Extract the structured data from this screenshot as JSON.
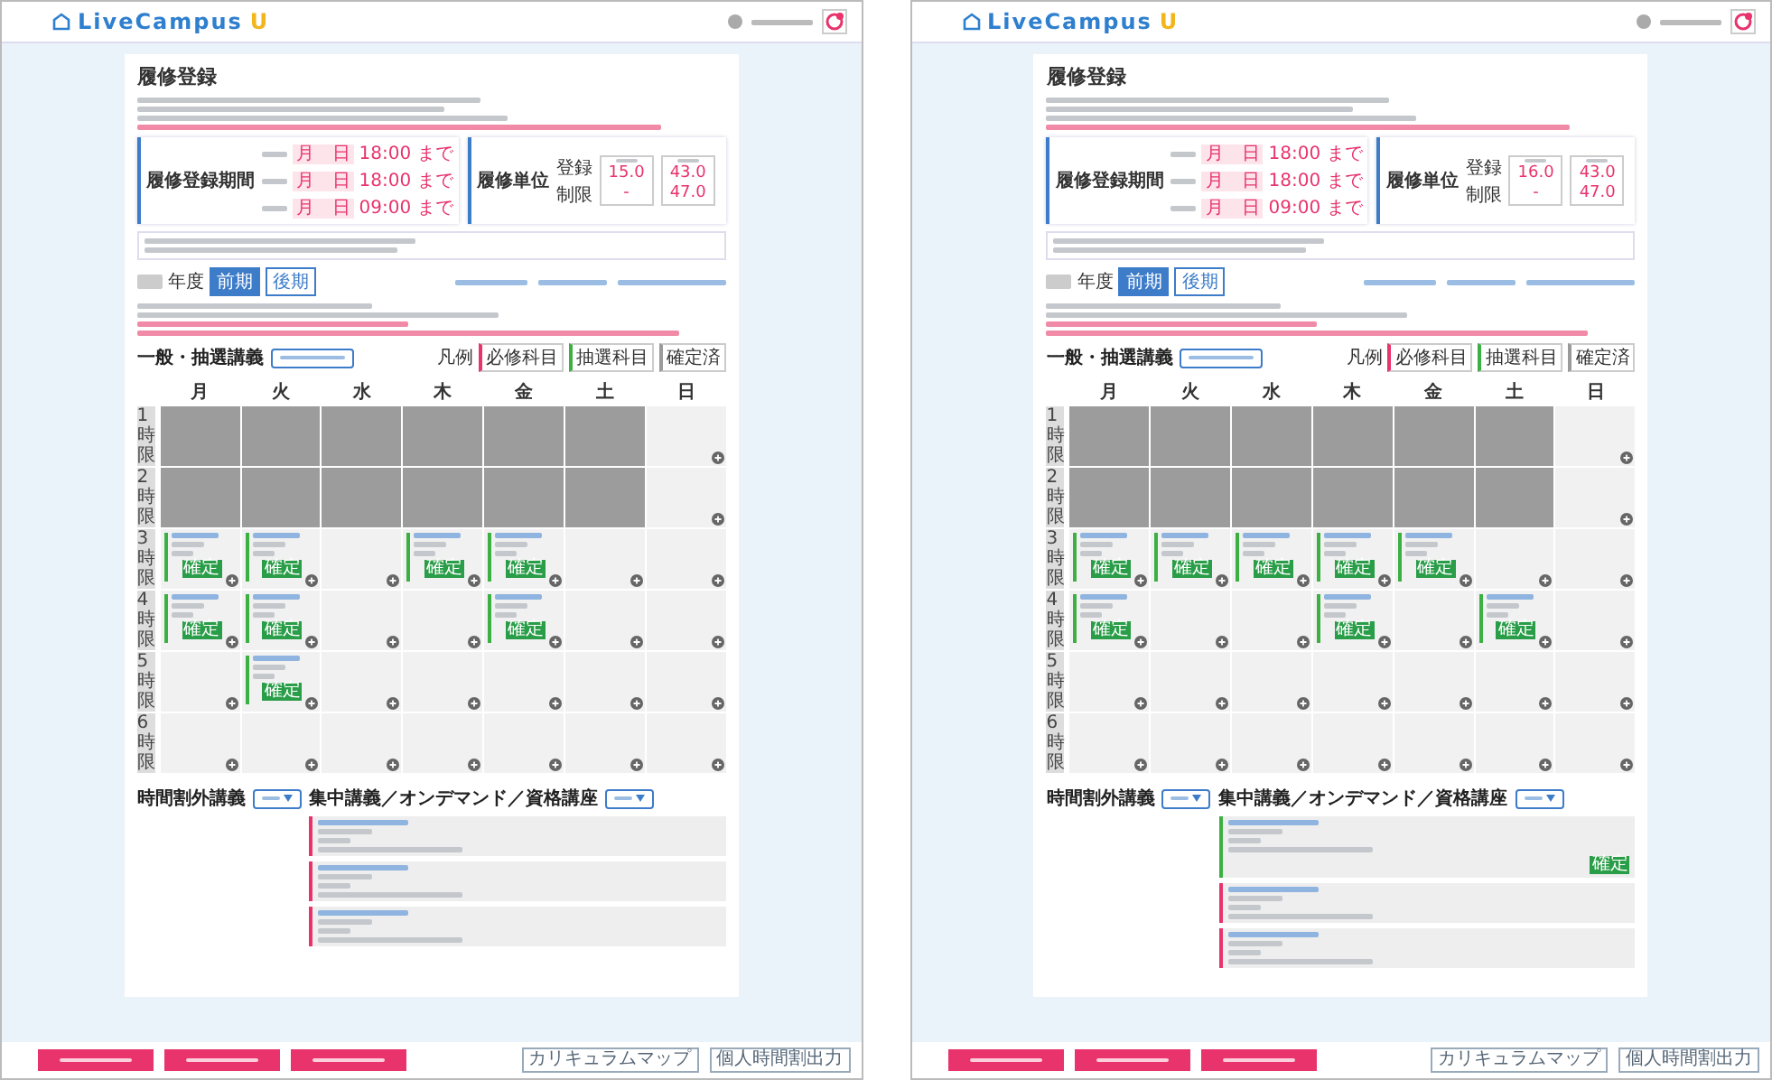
{
  "screens": [
    {
      "logo": {
        "name": "LiveCampus",
        "mark": "U"
      },
      "title": "履修登録",
      "period": {
        "label": "履修登録期間",
        "rows": [
          {
            "month": "月",
            "day": "日",
            "time": "18:00",
            "suffix": "まで"
          },
          {
            "month": "月",
            "day": "日",
            "time": "18:00",
            "suffix": "まで"
          },
          {
            "month": "月",
            "day": "日",
            "time": "09:00",
            "suffix": "まで"
          }
        ]
      },
      "units": {
        "label": "履修単位",
        "row_labels": [
          "登録",
          "制限"
        ],
        "columns": [
          [
            "15.0",
            "-"
          ],
          [
            "43.0",
            "47.0"
          ]
        ]
      },
      "year_suffix": "年度",
      "terms": [
        {
          "label": "前期",
          "selected": true
        },
        {
          "label": "後期",
          "selected": false
        }
      ],
      "grid_title": "一般・抽選講義",
      "legend": {
        "title": "凡例",
        "items": [
          {
            "label": "必修科目",
            "color": "#e8336d"
          },
          {
            "label": "抽選科目",
            "color": "#3cb043"
          },
          {
            "label": "確定済",
            "color": "#9a9a9a"
          }
        ]
      },
      "days": [
        "月",
        "火",
        "水",
        "木",
        "金",
        "土",
        "日"
      ],
      "periods": [
        "1時限",
        "2時限",
        "3時限",
        "4時限",
        "5時限",
        "6時限"
      ],
      "rows": [
        [
          {
            "kind": "blocked"
          },
          {
            "kind": "blocked"
          },
          {
            "kind": "blocked"
          },
          {
            "kind": "blocked"
          },
          {
            "kind": "blocked"
          },
          {
            "kind": "blocked"
          },
          {
            "kind": "empty"
          }
        ],
        [
          {
            "kind": "blocked"
          },
          {
            "kind": "blocked"
          },
          {
            "kind": "blocked"
          },
          {
            "kind": "blocked"
          },
          {
            "kind": "blocked"
          },
          {
            "kind": "blocked"
          },
          {
            "kind": "empty"
          }
        ],
        [
          {
            "kind": "course",
            "badge": "確定"
          },
          {
            "kind": "course",
            "badge": "確定"
          },
          {
            "kind": "empty"
          },
          {
            "kind": "course",
            "badge": "確定"
          },
          {
            "kind": "course",
            "badge": "確定"
          },
          {
            "kind": "empty"
          },
          {
            "kind": "empty"
          }
        ],
        [
          {
            "kind": "course",
            "badge": "確定"
          },
          {
            "kind": "course",
            "badge": "確定"
          },
          {
            "kind": "empty"
          },
          {
            "kind": "empty"
          },
          {
            "kind": "course",
            "badge": "確定"
          },
          {
            "kind": "empty"
          },
          {
            "kind": "empty"
          }
        ],
        [
          {
            "kind": "empty"
          },
          {
            "kind": "course",
            "badge": "確定"
          },
          {
            "kind": "empty"
          },
          {
            "kind": "empty"
          },
          {
            "kind": "empty"
          },
          {
            "kind": "empty"
          },
          {
            "kind": "empty"
          }
        ],
        [
          {
            "kind": "empty"
          },
          {
            "kind": "empty"
          },
          {
            "kind": "empty"
          },
          {
            "kind": "empty"
          },
          {
            "kind": "empty"
          },
          {
            "kind": "empty"
          },
          {
            "kind": "empty"
          }
        ]
      ],
      "extra_title": "時間割外講義",
      "intensive_title": "集中講義／オンデマンド／資格講座",
      "intensive": [
        {
          "color": "#e8336d"
        },
        {
          "color": "#e8336d"
        },
        {
          "color": "#e8336d"
        }
      ],
      "footer_right": [
        "カリキュラムマップ",
        "個人時間割出力"
      ]
    },
    {
      "logo": {
        "name": "LiveCampus",
        "mark": "U"
      },
      "title": "履修登録",
      "period": {
        "label": "履修登録期間",
        "rows": [
          {
            "month": "月",
            "day": "日",
            "time": "18:00",
            "suffix": "まで"
          },
          {
            "month": "月",
            "day": "日",
            "time": "18:00",
            "suffix": "まで"
          },
          {
            "month": "月",
            "day": "日",
            "time": "09:00",
            "suffix": "まで"
          }
        ]
      },
      "units": {
        "label": "履修単位",
        "row_labels": [
          "登録",
          "制限"
        ],
        "columns": [
          [
            "16.0",
            "-"
          ],
          [
            "43.0",
            "47.0"
          ]
        ]
      },
      "year_suffix": "年度",
      "terms": [
        {
          "label": "前期",
          "selected": true
        },
        {
          "label": "後期",
          "selected": false
        }
      ],
      "grid_title": "一般・抽選講義",
      "legend": {
        "title": "凡例",
        "items": [
          {
            "label": "必修科目",
            "color": "#e8336d"
          },
          {
            "label": "抽選科目",
            "color": "#3cb043"
          },
          {
            "label": "確定済",
            "color": "#9a9a9a"
          }
        ]
      },
      "days": [
        "月",
        "火",
        "水",
        "木",
        "金",
        "土",
        "日"
      ],
      "periods": [
        "1時限",
        "2時限",
        "3時限",
        "4時限",
        "5時限",
        "6時限"
      ],
      "rows": [
        [
          {
            "kind": "blocked"
          },
          {
            "kind": "blocked"
          },
          {
            "kind": "blocked"
          },
          {
            "kind": "blocked"
          },
          {
            "kind": "blocked"
          },
          {
            "kind": "blocked"
          },
          {
            "kind": "empty"
          }
        ],
        [
          {
            "kind": "blocked"
          },
          {
            "kind": "blocked"
          },
          {
            "kind": "blocked"
          },
          {
            "kind": "blocked"
          },
          {
            "kind": "blocked"
          },
          {
            "kind": "blocked"
          },
          {
            "kind": "empty"
          }
        ],
        [
          {
            "kind": "course",
            "badge": "確定"
          },
          {
            "kind": "course",
            "badge": "確定"
          },
          {
            "kind": "course",
            "badge": "確定"
          },
          {
            "kind": "course",
            "badge": "確定"
          },
          {
            "kind": "course",
            "badge": "確定"
          },
          {
            "kind": "empty"
          },
          {
            "kind": "empty"
          }
        ],
        [
          {
            "kind": "course",
            "badge": "確定"
          },
          {
            "kind": "empty"
          },
          {
            "kind": "empty"
          },
          {
            "kind": "course",
            "badge": "確定"
          },
          {
            "kind": "empty"
          },
          {
            "kind": "course",
            "badge": "確定"
          },
          {
            "kind": "empty"
          }
        ],
        [
          {
            "kind": "empty"
          },
          {
            "kind": "empty"
          },
          {
            "kind": "empty"
          },
          {
            "kind": "empty"
          },
          {
            "kind": "empty"
          },
          {
            "kind": "empty"
          },
          {
            "kind": "empty"
          }
        ],
        [
          {
            "kind": "empty"
          },
          {
            "kind": "empty"
          },
          {
            "kind": "empty"
          },
          {
            "kind": "empty"
          },
          {
            "kind": "empty"
          },
          {
            "kind": "empty"
          },
          {
            "kind": "empty"
          }
        ]
      ],
      "extra_title": "時間割外講義",
      "intensive_title": "集中講義／オンデマンド／資格講座",
      "intensive": [
        {
          "color": "#3cb043",
          "badge": "確定"
        },
        {
          "color": "#e8336d"
        },
        {
          "color": "#e8336d"
        }
      ],
      "footer_right": [
        "カリキュラムマップ",
        "個人時間割出力"
      ]
    }
  ]
}
